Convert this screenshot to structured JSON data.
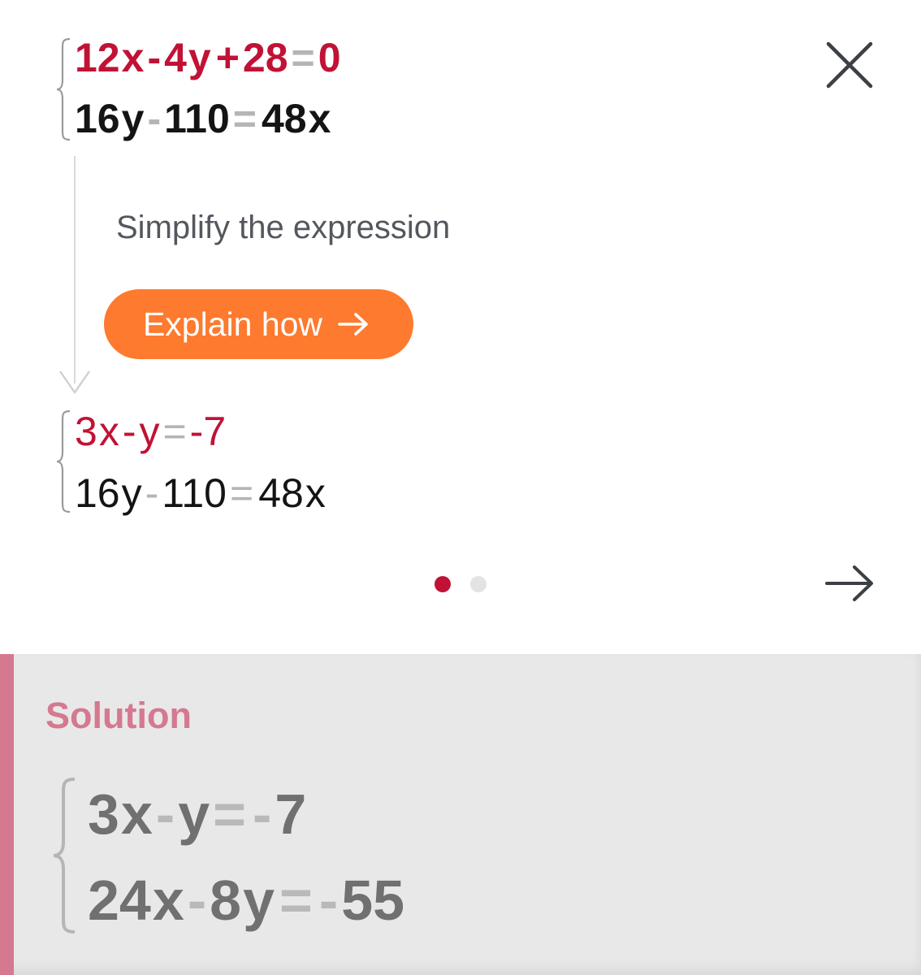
{
  "step": {
    "before": {
      "eq1": {
        "a": "12",
        "x": "x",
        "op1": "-",
        "b": "4",
        "y": "y",
        "op2": "+",
        "c": "28",
        "eq": "=",
        "r": "0"
      },
      "eq2": {
        "a": "16",
        "y": "y",
        "op1": "-",
        "b": "110",
        "eq": "=",
        "c": "48",
        "x": "x"
      }
    },
    "description": "Simplify the expression",
    "explain_label": "Explain how",
    "after": {
      "eq1": {
        "a": "3",
        "x": "x",
        "op1": "-",
        "y": "y",
        "eq": "=",
        "neg": "-",
        "r": "7"
      },
      "eq2": {
        "a": "16",
        "y": "y",
        "op1": "-",
        "b": "110",
        "eq": "=",
        "c": "48",
        "x": "x"
      }
    }
  },
  "pagination": {
    "current": 1,
    "total": 2
  },
  "solution": {
    "title": "Solution",
    "eq1": {
      "a": "3",
      "x": "x",
      "op1": "-",
      "y": "y",
      "eq": "=",
      "neg": "-",
      "r": "7"
    },
    "eq2": {
      "a": "24",
      "x": "x",
      "op1": "-",
      "b": "8",
      "y": "y",
      "eq": "=",
      "neg": "-",
      "r": "55"
    }
  },
  "icons": {
    "close": "close-icon",
    "next": "arrow-right-icon",
    "explain": "arrow-right-icon",
    "step": "arrow-down-icon"
  },
  "colors": {
    "accent_red": "#c11236",
    "button_orange": "#fd7a2e",
    "solution_pink": "#d4798f"
  }
}
